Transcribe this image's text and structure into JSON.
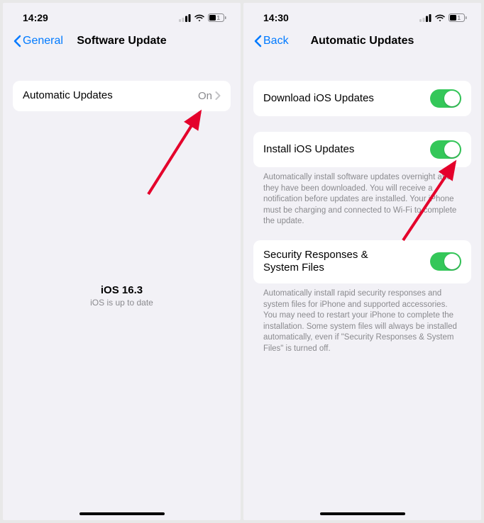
{
  "left": {
    "status": {
      "time": "14:29"
    },
    "nav": {
      "back": "General",
      "title": "Software Update"
    },
    "row": {
      "label": "Automatic Updates",
      "value": "On"
    },
    "center": {
      "version": "iOS 16.3",
      "status": "iOS is up to date"
    }
  },
  "right": {
    "status": {
      "time": "14:30"
    },
    "nav": {
      "back": "Back",
      "title": "Automatic Updates"
    },
    "rows": {
      "download": {
        "label": "Download iOS Updates"
      },
      "install": {
        "label": "Install iOS Updates",
        "footer": "Automatically install software updates overnight after they have been downloaded. You will receive a notification before updates are installed. Your iPhone must be charging and connected to Wi-Fi to complete the update."
      },
      "security": {
        "label": "Security Responses & System Files",
        "footer": "Automatically install rapid security responses and system files for iPhone and supported accessories. You may need to restart your iPhone to complete the installation. Some system files will always be installed automatically, even if \"Security Responses & System Files\" is turned off."
      }
    }
  }
}
